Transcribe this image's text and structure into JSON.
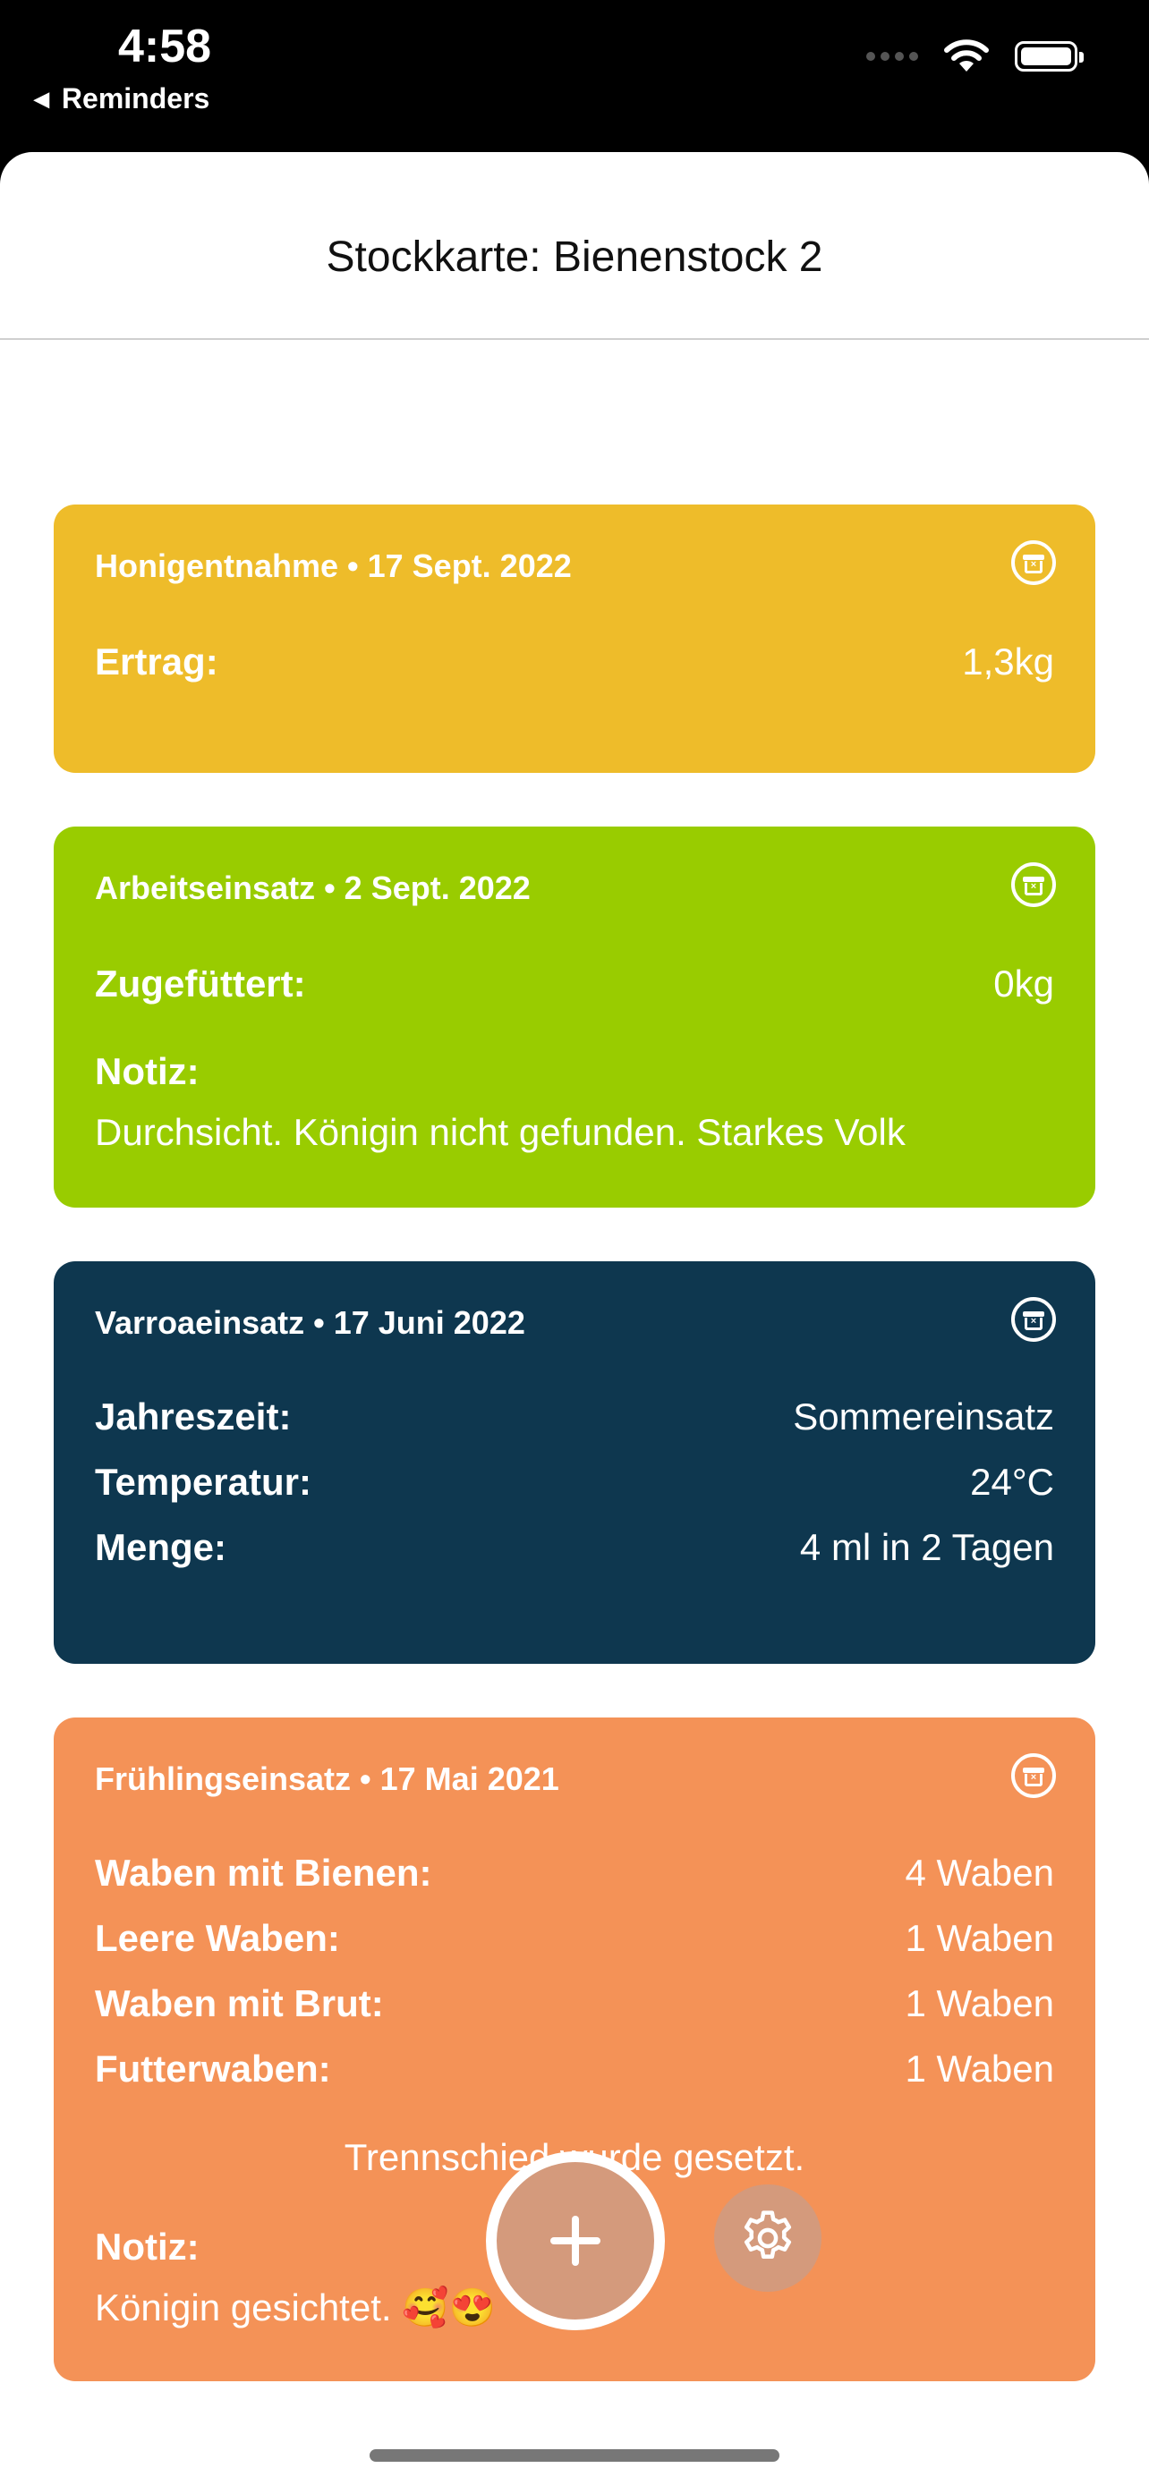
{
  "status": {
    "time": "4:58",
    "back_app": "Reminders"
  },
  "nav": {
    "title": "Stockkarte: Bienenstock 2"
  },
  "cards": [
    {
      "header": "Honigentnahme • 17 Sept. 2022",
      "color": "#EEBC2A",
      "rows": [
        {
          "label": "Ertrag:",
          "value": "1,3kg"
        }
      ]
    },
    {
      "header": "Arbeitseinsatz • 2 Sept. 2022",
      "color": "#99CC00",
      "rows": [
        {
          "label": "Zugefüttert:",
          "value": "0kg"
        }
      ],
      "note_label": "Notiz:",
      "note_text": "Durchsicht. Königin nicht gefunden. Starkes Volk"
    },
    {
      "header": "Varroaeinsatz • 17 Juni 2022",
      "color": "#0E374F",
      "rows": [
        {
          "label": "Jahreszeit:",
          "value": "Sommereinsatz"
        },
        {
          "label": "Temperatur:",
          "value": "24°C"
        },
        {
          "label": "Menge:",
          "value": "4 ml in 2 Tagen"
        }
      ]
    },
    {
      "header": "Frühlingseinsatz • 17 Mai 2021",
      "color": "#F49257",
      "rows": [
        {
          "label": "Waben mit Bienen:",
          "value": "4 Waben"
        },
        {
          "label": "Leere Waben:",
          "value": "1 Waben"
        },
        {
          "label": "Waben mit Brut:",
          "value": "1 Waben"
        },
        {
          "label": "Futterwaben:",
          "value": "1 Waben"
        }
      ],
      "center_text": "Trennschied wurde gesetzt.",
      "note_label": "Notiz:",
      "note_text": "Königin gesichtet. 🥰😍"
    }
  ],
  "icons": {
    "card_action": "archive-icon",
    "fab": "plus-icon",
    "settings": "gear-icon"
  }
}
